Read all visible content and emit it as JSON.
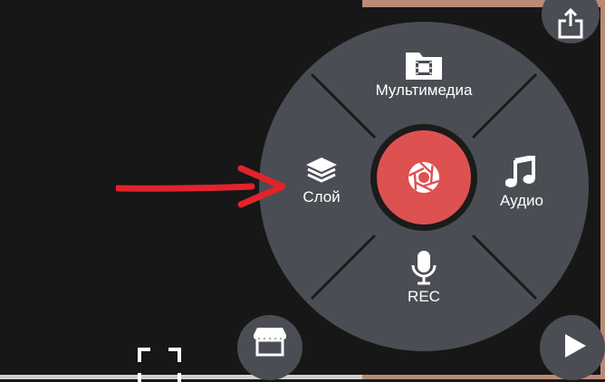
{
  "menu": {
    "media_label": "Мультимедиа",
    "layer_label": "Слой",
    "audio_label": "Аудио",
    "rec_label": "REC"
  },
  "colors": {
    "background": "#171717",
    "wheel": "#4b4d54",
    "capture_accent": "#de5151",
    "annotation_arrow": "#e3232b",
    "text": "#ffffff"
  },
  "icons": {
    "media": "film-folder-icon",
    "layer": "layers-icon",
    "audio": "music-note-icon",
    "rec": "microphone-icon",
    "capture": "camera-shutter-icon",
    "share": "share-export-icon",
    "store": "store-icon",
    "play": "play-icon",
    "fullscreen": "fullscreen-icon"
  }
}
